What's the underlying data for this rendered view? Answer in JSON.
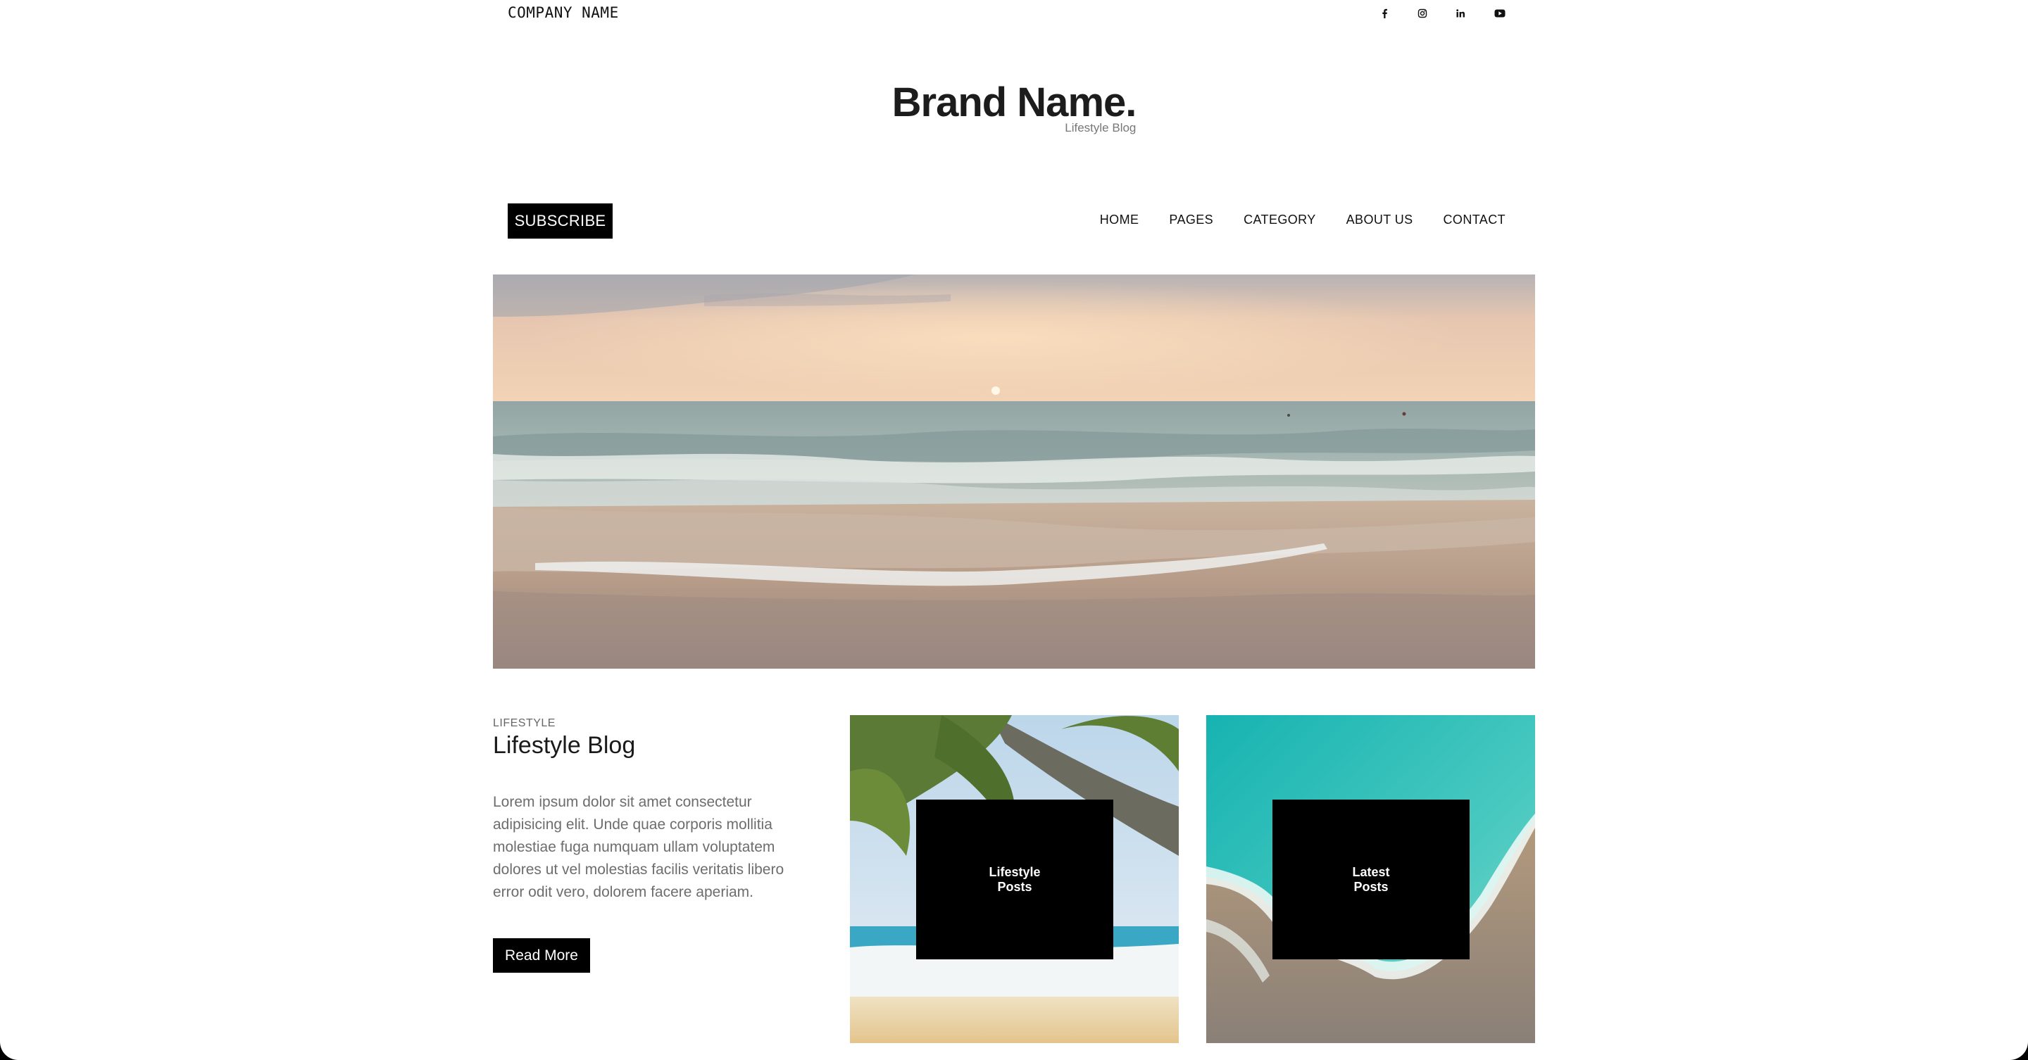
{
  "header": {
    "company_name": "COMPANY NAME",
    "social_icons": [
      "facebook-icon",
      "instagram-icon",
      "linkedin-icon",
      "youtube-icon"
    ]
  },
  "brand": {
    "name": "Brand Name.",
    "tagline": "Lifestyle Blog"
  },
  "nav": {
    "subscribe_label": "SUBSCRIBE",
    "items": [
      {
        "label": "HOME"
      },
      {
        "label": "PAGES"
      },
      {
        "label": "CATEGORY"
      },
      {
        "label": "ABOUT US"
      },
      {
        "label": "CONTACT"
      }
    ]
  },
  "main": {
    "category": "LIFESTYLE",
    "title": "Lifestyle Blog",
    "body": "Lorem ipsum dolor sit amet consectetur adipisicing elit. Unde quae corporis mollitia molestiae fuga numquam ullam voluptatem dolores ut vel molestias facilis veritatis libero error odit vero, dolorem facere aperiam.",
    "read_more_label": "Read More",
    "cards": [
      {
        "label": "Lifestyle Posts"
      },
      {
        "label": "Latest Posts"
      }
    ]
  },
  "colors": {
    "button_bg": "#000000",
    "button_text": "#ffffff",
    "body_text": "#6d6d6d"
  }
}
